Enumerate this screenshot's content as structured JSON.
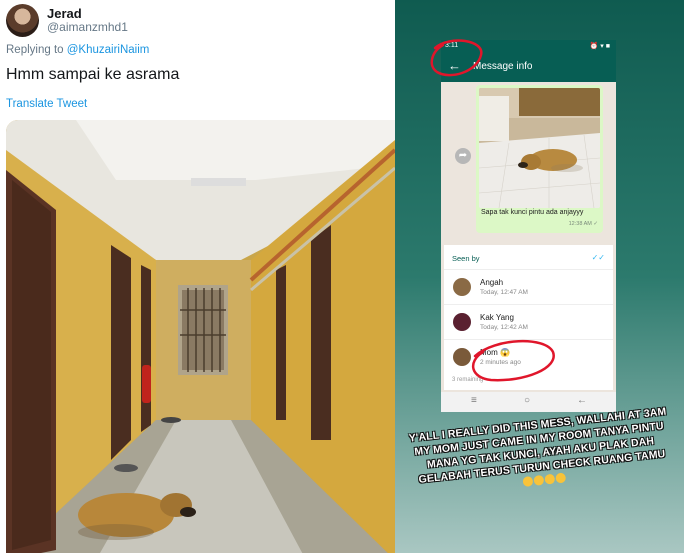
{
  "tweet": {
    "display_name": "Jerad",
    "handle": "@aimanzmhd1",
    "replying_prefix": "Replying to",
    "replying_to": "@KhuzairiNaiim",
    "text": "Hmm sampai ke asrama",
    "translate_label": "Translate Tweet"
  },
  "story": {
    "status_time": "3:11",
    "status_icons": "⏰ ▾ ■",
    "app_title": "Message info",
    "back_icon": "arrow-left-icon",
    "forward_icon": "forward-icon",
    "message_caption": "Sapa tak kunci pintu ada anjayyy",
    "message_time": "12:38 AM ✓",
    "seen_by_label": "Seen by",
    "viewers": [
      {
        "name": "Angah",
        "time": "Today, 12:47 AM",
        "color": "#8a6a45"
      },
      {
        "name": "Kak Yang",
        "time": "Today, 12:42 AM",
        "color": "#5a2030"
      },
      {
        "name": "Mom 😱",
        "time": "2 minutes ago",
        "color": "#7a5a3a"
      }
    ],
    "remaining": "3 remaining",
    "caption": "Y'ALL I REALLY DID THIS MESS, WALLAHI AT 3AM MY MOM JUST CAME IN MY ROOM TANYA PINTU MANA YG TAK KUNCI, AYAH AKU PLAK DAH GELABAH TERUS TURUN CHECK RUANG TAMU",
    "annotation_color": "#e0162b"
  }
}
